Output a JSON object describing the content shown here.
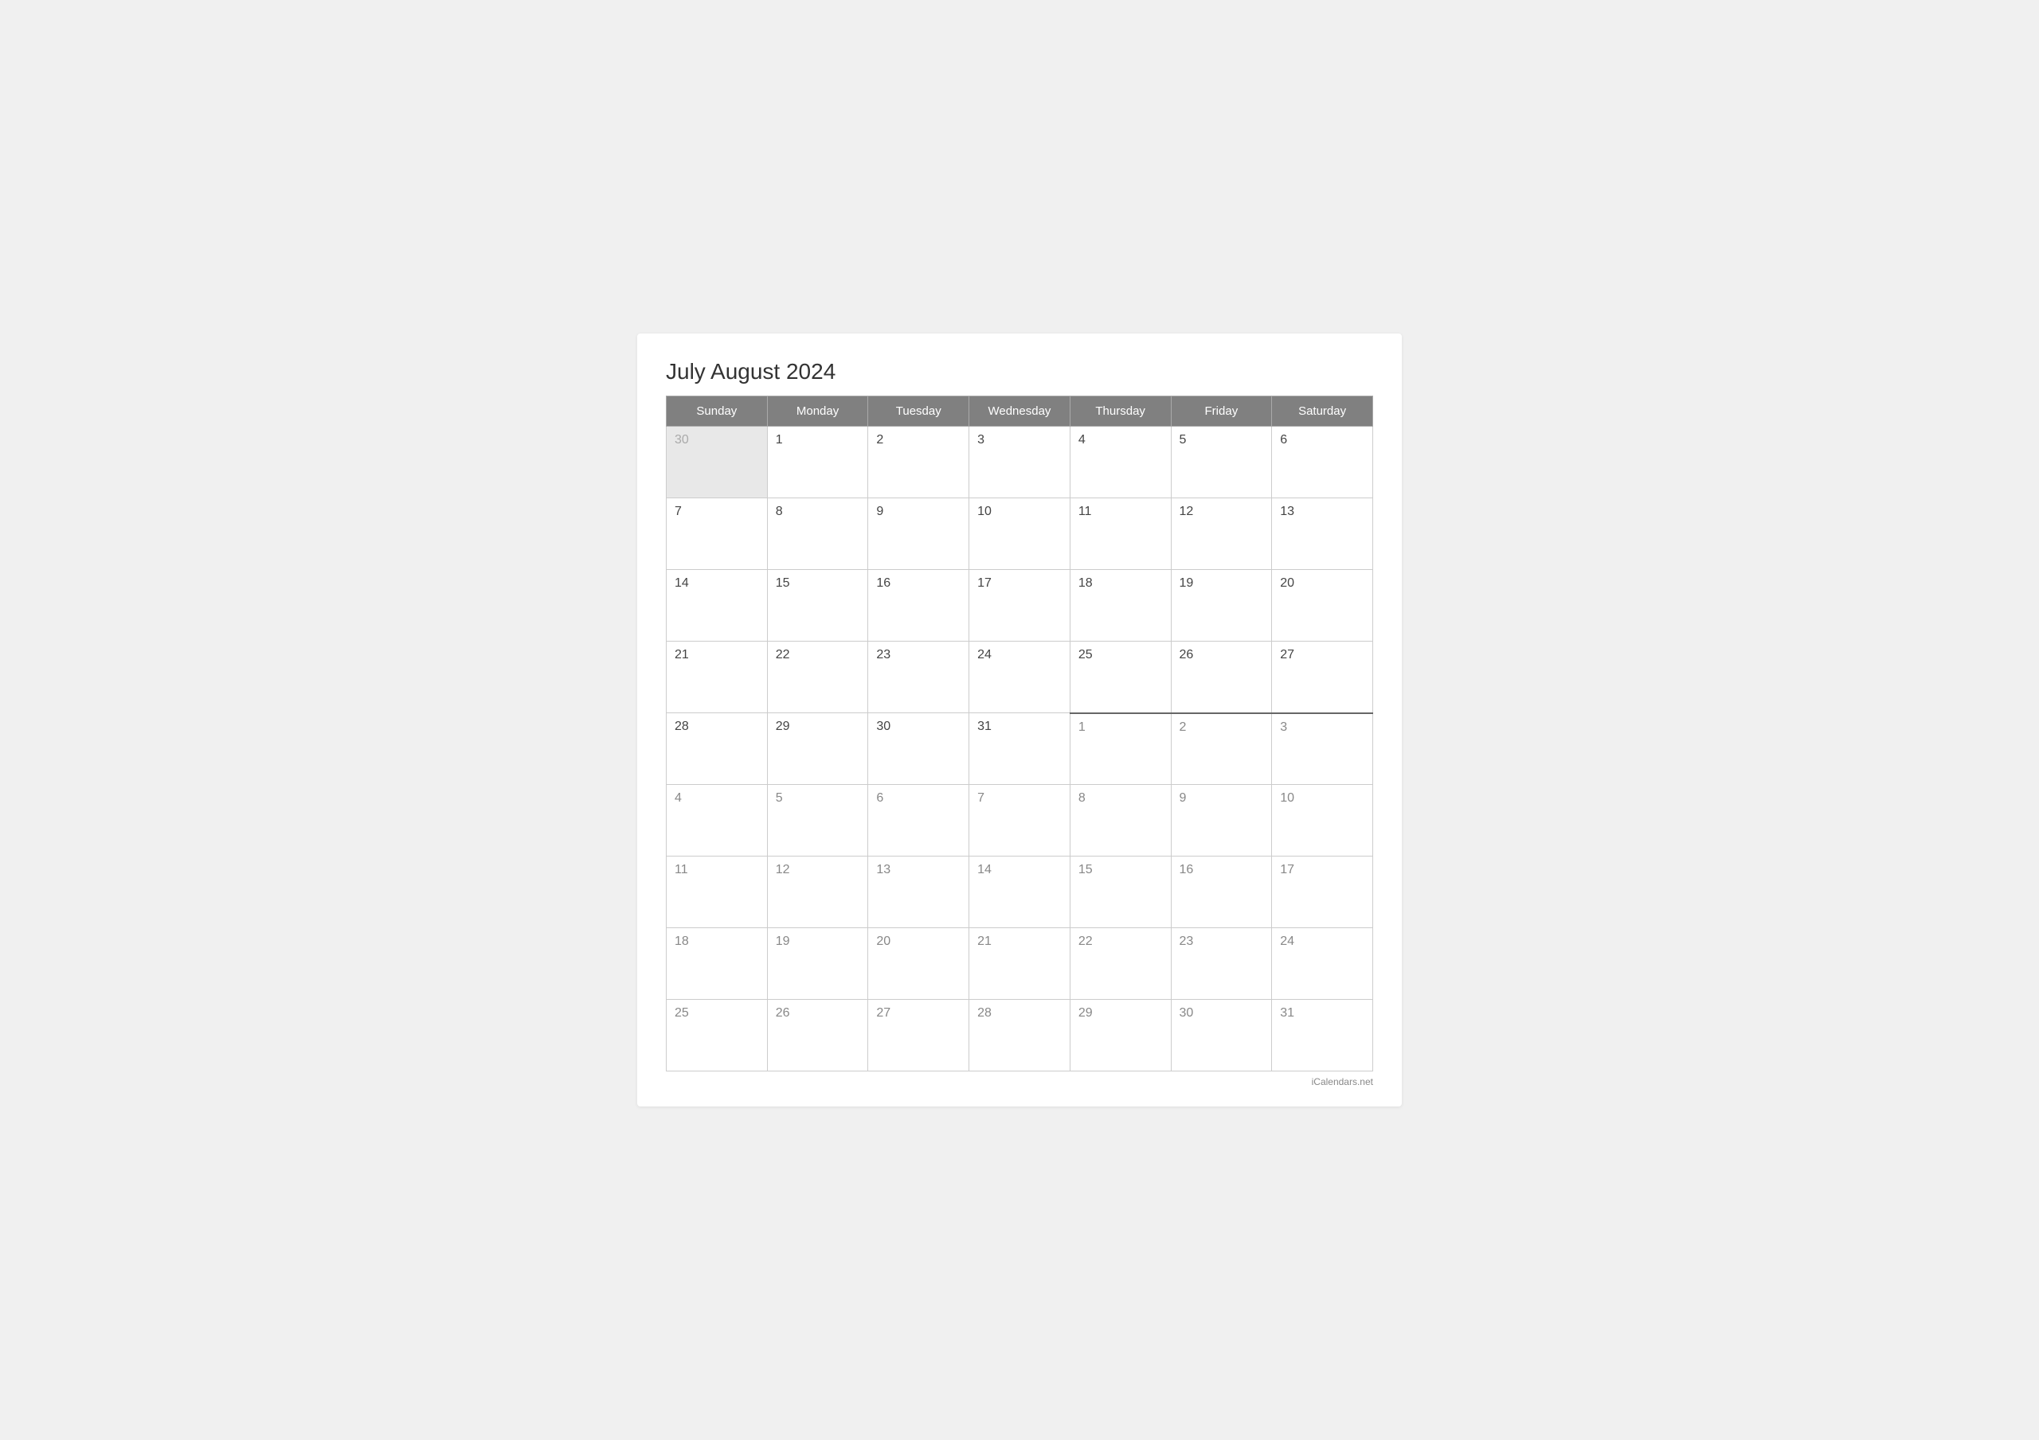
{
  "title": "July August 2024",
  "days_of_week": [
    "Sunday",
    "Monday",
    "Tuesday",
    "Wednesday",
    "Thursday",
    "Friday",
    "Saturday"
  ],
  "weeks": [
    [
      {
        "day": "30",
        "type": "prev-month"
      },
      {
        "day": "1",
        "type": "current"
      },
      {
        "day": "2",
        "type": "current"
      },
      {
        "day": "3",
        "type": "current"
      },
      {
        "day": "4",
        "type": "current"
      },
      {
        "day": "5",
        "type": "current"
      },
      {
        "day": "6",
        "type": "current"
      }
    ],
    [
      {
        "day": "7",
        "type": "current"
      },
      {
        "day": "8",
        "type": "current"
      },
      {
        "day": "9",
        "type": "current"
      },
      {
        "day": "10",
        "type": "current"
      },
      {
        "day": "11",
        "type": "current"
      },
      {
        "day": "12",
        "type": "current"
      },
      {
        "day": "13",
        "type": "current"
      }
    ],
    [
      {
        "day": "14",
        "type": "current"
      },
      {
        "day": "15",
        "type": "current"
      },
      {
        "day": "16",
        "type": "current"
      },
      {
        "day": "17",
        "type": "current"
      },
      {
        "day": "18",
        "type": "current"
      },
      {
        "day": "19",
        "type": "current"
      },
      {
        "day": "20",
        "type": "current"
      }
    ],
    [
      {
        "day": "21",
        "type": "current"
      },
      {
        "day": "22",
        "type": "current"
      },
      {
        "day": "23",
        "type": "current"
      },
      {
        "day": "24",
        "type": "current"
      },
      {
        "day": "25",
        "type": "current"
      },
      {
        "day": "26",
        "type": "current"
      },
      {
        "day": "27",
        "type": "current"
      }
    ],
    [
      {
        "day": "28",
        "type": "current"
      },
      {
        "day": "29",
        "type": "current"
      },
      {
        "day": "30",
        "type": "current"
      },
      {
        "day": "31",
        "type": "current"
      },
      {
        "day": "1",
        "type": "next-month month-border-top"
      },
      {
        "day": "2",
        "type": "next-month month-border-top"
      },
      {
        "day": "3",
        "type": "next-month month-border-top"
      }
    ],
    [
      {
        "day": "4",
        "type": "next-month"
      },
      {
        "day": "5",
        "type": "next-month"
      },
      {
        "day": "6",
        "type": "next-month"
      },
      {
        "day": "7",
        "type": "next-month"
      },
      {
        "day": "8",
        "type": "next-month"
      },
      {
        "day": "9",
        "type": "next-month"
      },
      {
        "day": "10",
        "type": "next-month"
      }
    ],
    [
      {
        "day": "11",
        "type": "next-month"
      },
      {
        "day": "12",
        "type": "next-month"
      },
      {
        "day": "13",
        "type": "next-month"
      },
      {
        "day": "14",
        "type": "next-month"
      },
      {
        "day": "15",
        "type": "next-month"
      },
      {
        "day": "16",
        "type": "next-month"
      },
      {
        "day": "17",
        "type": "next-month"
      }
    ],
    [
      {
        "day": "18",
        "type": "next-month"
      },
      {
        "day": "19",
        "type": "next-month"
      },
      {
        "day": "20",
        "type": "next-month"
      },
      {
        "day": "21",
        "type": "next-month"
      },
      {
        "day": "22",
        "type": "next-month"
      },
      {
        "day": "23",
        "type": "next-month"
      },
      {
        "day": "24",
        "type": "next-month"
      }
    ],
    [
      {
        "day": "25",
        "type": "next-month"
      },
      {
        "day": "26",
        "type": "next-month"
      },
      {
        "day": "27",
        "type": "next-month"
      },
      {
        "day": "28",
        "type": "next-month"
      },
      {
        "day": "29",
        "type": "next-month"
      },
      {
        "day": "30",
        "type": "next-month"
      },
      {
        "day": "31",
        "type": "next-month"
      }
    ]
  ],
  "footer": "iCalendars.net"
}
